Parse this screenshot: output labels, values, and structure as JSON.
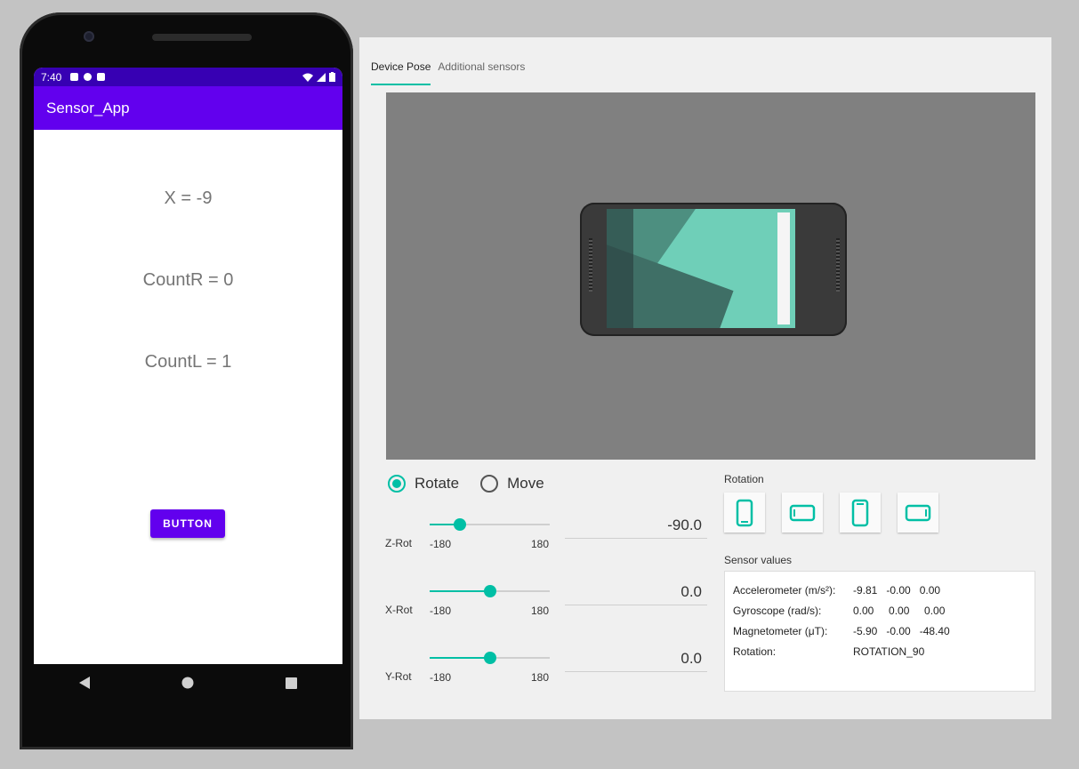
{
  "phone": {
    "status": {
      "time": "7:40"
    },
    "app_title": "Sensor_App",
    "readouts": [
      "X = -9",
      "CountR = 0",
      "CountL = 1"
    ],
    "button_label": "BUTTON"
  },
  "panel": {
    "tabs": [
      {
        "label": "Device Pose",
        "active": true
      },
      {
        "label": "Additional sensors",
        "active": false
      }
    ],
    "modes": {
      "rotate": "Rotate",
      "move": "Move",
      "selected": "rotate"
    },
    "sliders": [
      {
        "label": "Z-Rot",
        "min_label": "-180",
        "max_label": "180",
        "value_text": "-90.0",
        "value": -90,
        "min": -180,
        "max": 180
      },
      {
        "label": "X-Rot",
        "min_label": "-180",
        "max_label": "180",
        "value_text": "0.0",
        "value": 0,
        "min": -180,
        "max": 180
      },
      {
        "label": "Y-Rot",
        "min_label": "-180",
        "max_label": "180",
        "value_text": "0.0",
        "value": 0,
        "min": -180,
        "max": 180
      }
    ],
    "rotation_label": "Rotation",
    "rotation_buttons": [
      "portrait",
      "landscape",
      "reverse-portrait",
      "reverse-landscape"
    ],
    "sensor_values_label": "Sensor values",
    "sensors": [
      {
        "name": "Accelerometer (m/s²):",
        "values": "-9.81   -0.00   0.00"
      },
      {
        "name": "Gyroscope (rad/s):",
        "values": "0.00     0.00     0.00"
      },
      {
        "name": "Magnetometer (μT):",
        "values": "-5.90   -0.00   -48.40"
      },
      {
        "name": "Rotation:",
        "values": "ROTATION_90"
      }
    ],
    "accent_color": "#00bfa5"
  },
  "colors": {
    "app_bar": "#6200ee",
    "status_bar": "#3700b3"
  }
}
